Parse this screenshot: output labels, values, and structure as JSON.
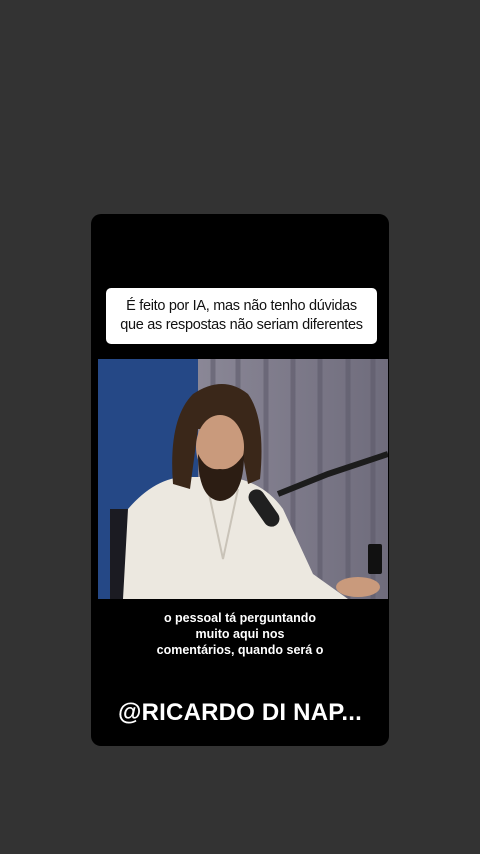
{
  "caption": {
    "line1": "É feito por IA, mas não tenho dúvidas",
    "line2": "que as respostas não seriam diferentes"
  },
  "video": {
    "subtitle_lines": [
      "o pessoal tá perguntando",
      "muito aqui nos",
      "comentários, quando será o"
    ]
  },
  "handle": "@RICARDO DI NAP...",
  "colors": {
    "page_background": "#333333",
    "card_background": "#000000",
    "caption_background": "#ffffff"
  }
}
